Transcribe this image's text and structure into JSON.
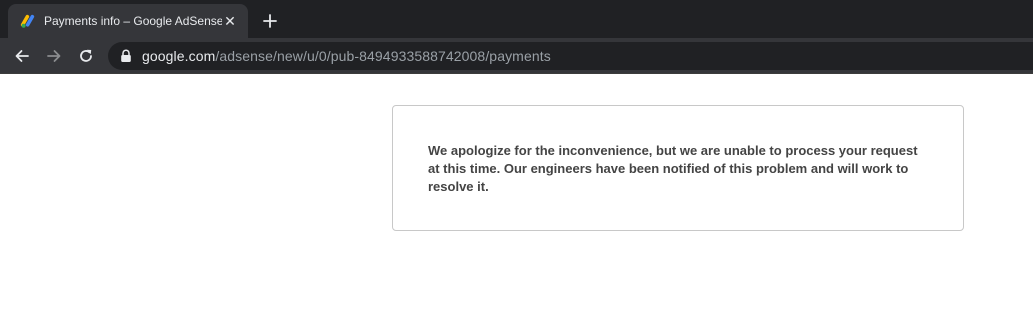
{
  "browser": {
    "tab": {
      "title": "Payments info – Google AdSense",
      "favicon": "adsense-logo-icon",
      "close_glyph": "✕"
    },
    "new_tab_icon": "plus-icon",
    "toolbar": {
      "back_icon": "arrow-left-icon",
      "forward_icon": "arrow-right-icon",
      "reload_icon": "reload-icon",
      "lock_icon": "lock-icon"
    },
    "omnibox": {
      "host": "google.com",
      "path": "/adsense/new/u/0/pub-8494933588742008/payments"
    }
  },
  "page": {
    "error_message": "We apologize for the inconvenience, but we are unable to process your request at this time. Our engineers have been notified of this problem and will work to resolve it."
  },
  "colors": {
    "tabstrip_bg": "#202124",
    "toolbar_bg": "#35363a",
    "omnibox_bg": "#202124",
    "text_light": "#e8eaed",
    "text_dim": "#9aa0a6",
    "card_border": "#c8c8c8",
    "message_text": "#444444",
    "adsense_yellow": "#fbbc04",
    "adsense_blue": "#4285f4",
    "adsense_green": "#34a853"
  }
}
